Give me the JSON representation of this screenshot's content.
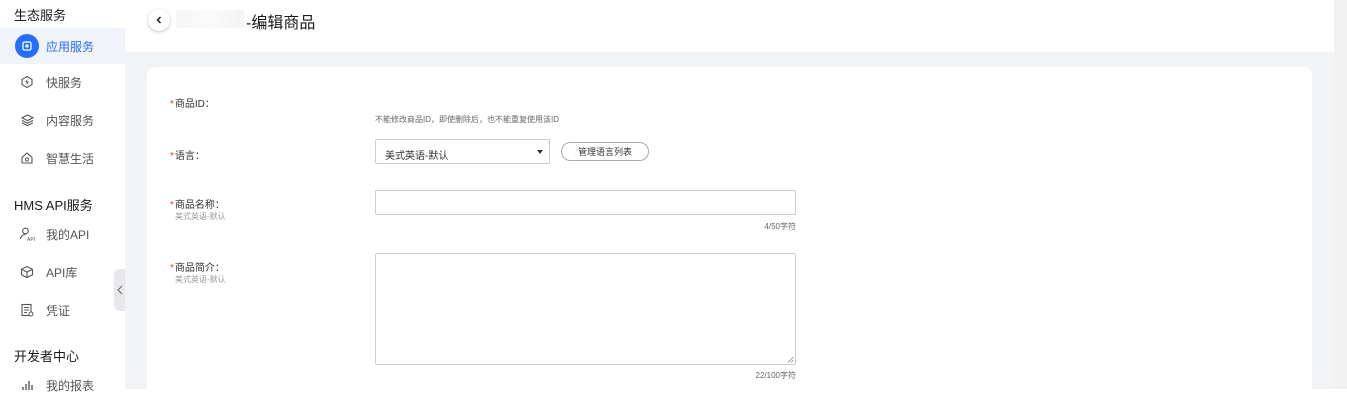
{
  "sidebar": {
    "sections": [
      {
        "title": "生态服务"
      },
      {
        "title": "HMS API服务"
      },
      {
        "title": "开发者中心"
      }
    ],
    "items": [
      {
        "label": "应用服务",
        "icon": "app-service-icon"
      },
      {
        "label": "快服务",
        "icon": "quick-service-icon"
      },
      {
        "label": "内容服务",
        "icon": "content-layers-icon"
      },
      {
        "label": "智慧生活",
        "icon": "smart-home-icon"
      },
      {
        "label": "我的API",
        "icon": "user-api-icon"
      },
      {
        "label": "API库",
        "icon": "cube-icon"
      },
      {
        "label": "凭证",
        "icon": "credential-icon"
      },
      {
        "label": "我的报表",
        "icon": "bar-chart-icon"
      }
    ]
  },
  "header": {
    "title": "-编辑商品"
  },
  "form": {
    "product_id": {
      "label": "商品ID：",
      "hint": "不能修改商品ID，即使删除后，也不能重复使用该ID"
    },
    "language": {
      "label": "语言：",
      "selected": "美式英语-默认",
      "manage_button": "管理语言列表"
    },
    "product_name": {
      "label": "商品名称：",
      "sub_label": "美式英语-默认",
      "value": "",
      "counter": "4/50字符"
    },
    "product_desc": {
      "label": "商品简介：",
      "sub_label": "美式英语-默认",
      "value": "",
      "counter": "22/100字符"
    }
  },
  "colors": {
    "accent": "#256fff",
    "required": "#e84026",
    "page_bg": "#f1f3f5"
  }
}
